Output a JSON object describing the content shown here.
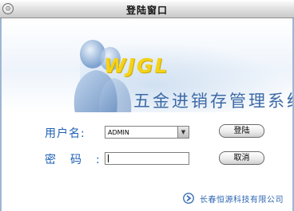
{
  "window": {
    "title": "登陆窗口",
    "system_button": "⊙"
  },
  "banner": {
    "logo_text": "WJGL",
    "subtitle": "五金进销存管理系统"
  },
  "form": {
    "username_label": "用户名:",
    "username_value": "ADMIN",
    "password_label": "密码:",
    "password_value": "",
    "login_button": "登陆",
    "cancel_button": "取消"
  },
  "footer": {
    "company": "长春恒源科技有限公司"
  },
  "colors": {
    "label_blue": "#1f5fb4",
    "logo_yellow": "#f3d21a",
    "subtitle_blue": "#3d6aa6"
  }
}
